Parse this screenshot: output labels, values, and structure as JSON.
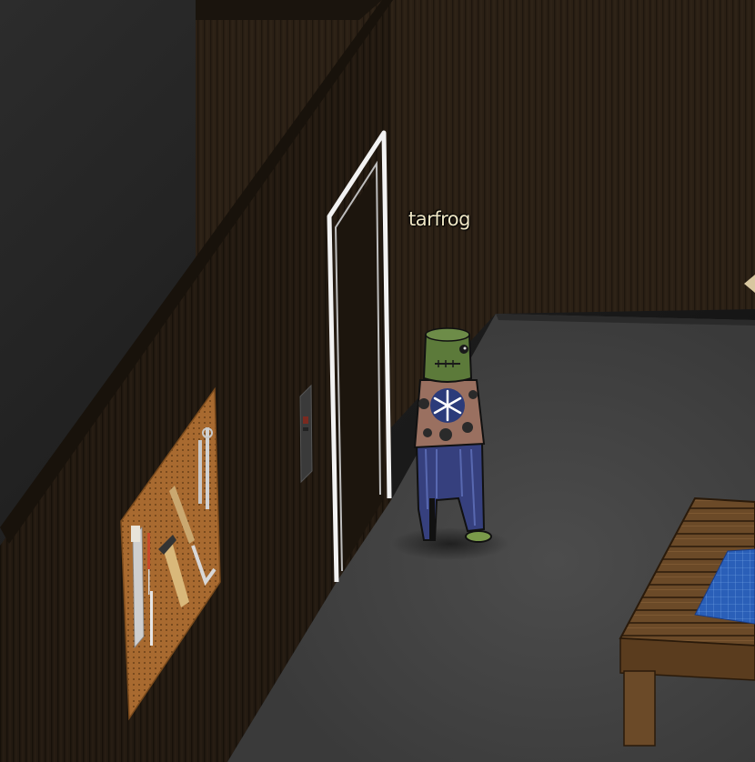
{
  "player": {
    "name": "tarfrog"
  },
  "colors": {
    "wall": "#2a1f14",
    "floor": "#474747",
    "void": "#141414",
    "door_frame": "#ffffff",
    "pegboard": "#a86a30",
    "table_wood": "#6b4a28",
    "blueprint": "#2a5fb8",
    "avatar_head": "#5c7a3a",
    "avatar_shirt": "#9a7060",
    "avatar_pants": "#36407e",
    "name_text": "#efe6c4"
  },
  "icons": [
    "door-frame",
    "wall-pegboard",
    "wall-switch-panel",
    "tool-saw",
    "tool-hammer",
    "tool-screwdriver",
    "tool-wrench",
    "tool-square",
    "workbench-table",
    "blueprint-sheet",
    "player-avatar"
  ]
}
